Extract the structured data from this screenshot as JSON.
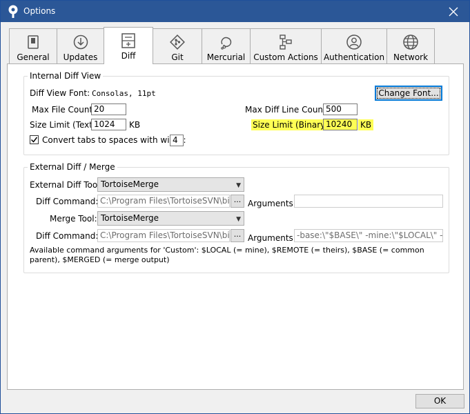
{
  "window": {
    "title": "Options",
    "close": "✕"
  },
  "tabs": [
    {
      "label": "General"
    },
    {
      "label": "Updates"
    },
    {
      "label": "Diff"
    },
    {
      "label": "Git"
    },
    {
      "label": "Mercurial"
    },
    {
      "label": "Custom Actions"
    },
    {
      "label": "Authentication"
    },
    {
      "label": "Network"
    }
  ],
  "internal": {
    "title": "Internal Diff View",
    "font_label": "Diff View Font:",
    "font_value": "Consolas, 11pt",
    "change_font": "Change Font...",
    "max_file_label": "Max File Count:",
    "max_file_value": "20",
    "max_line_label": "Max Diff Line Count:",
    "max_line_value": "500",
    "size_text_label": "Size Limit (Text):",
    "size_text_value": "1024",
    "size_text_unit": "KB",
    "size_bin_label": "Size Limit (Binary):",
    "size_bin_value": "10240",
    "size_bin_unit": "KB",
    "tabs_label": "Convert tabs to spaces with width:",
    "tabs_value": "4",
    "tabs_checked": true
  },
  "external": {
    "title": "External Diff / Merge",
    "diff_tool_label": "External Diff Tool:",
    "diff_tool_value": "TortoiseMerge",
    "diff_cmd_label": "Diff Command:",
    "diff_cmd_value": "C:\\Program Files\\TortoiseSVN\\bin\\T",
    "browse": "...",
    "args_label": "Arguments:",
    "diff_args_value": "",
    "merge_tool_label": "Merge Tool:",
    "merge_tool_value": "TortoiseMerge",
    "merge_cmd_label": "Diff Command:",
    "merge_cmd_value": "C:\\Program Files\\TortoiseSVN\\bin\\T",
    "merge_args_value": "-base:\\\"$BASE\\\" -mine:\\\"$LOCAL\\\" -the",
    "help_text": "Available command arguments for 'Custom': $LOCAL (= mine), $REMOTE (= theirs), $BASE (= common parent), $MERGED (= merge output)"
  },
  "footer": {
    "ok": "OK"
  },
  "colors": {
    "titlebar": "#2b5797",
    "highlight": "#ffff55",
    "focus": "#0078d7"
  }
}
